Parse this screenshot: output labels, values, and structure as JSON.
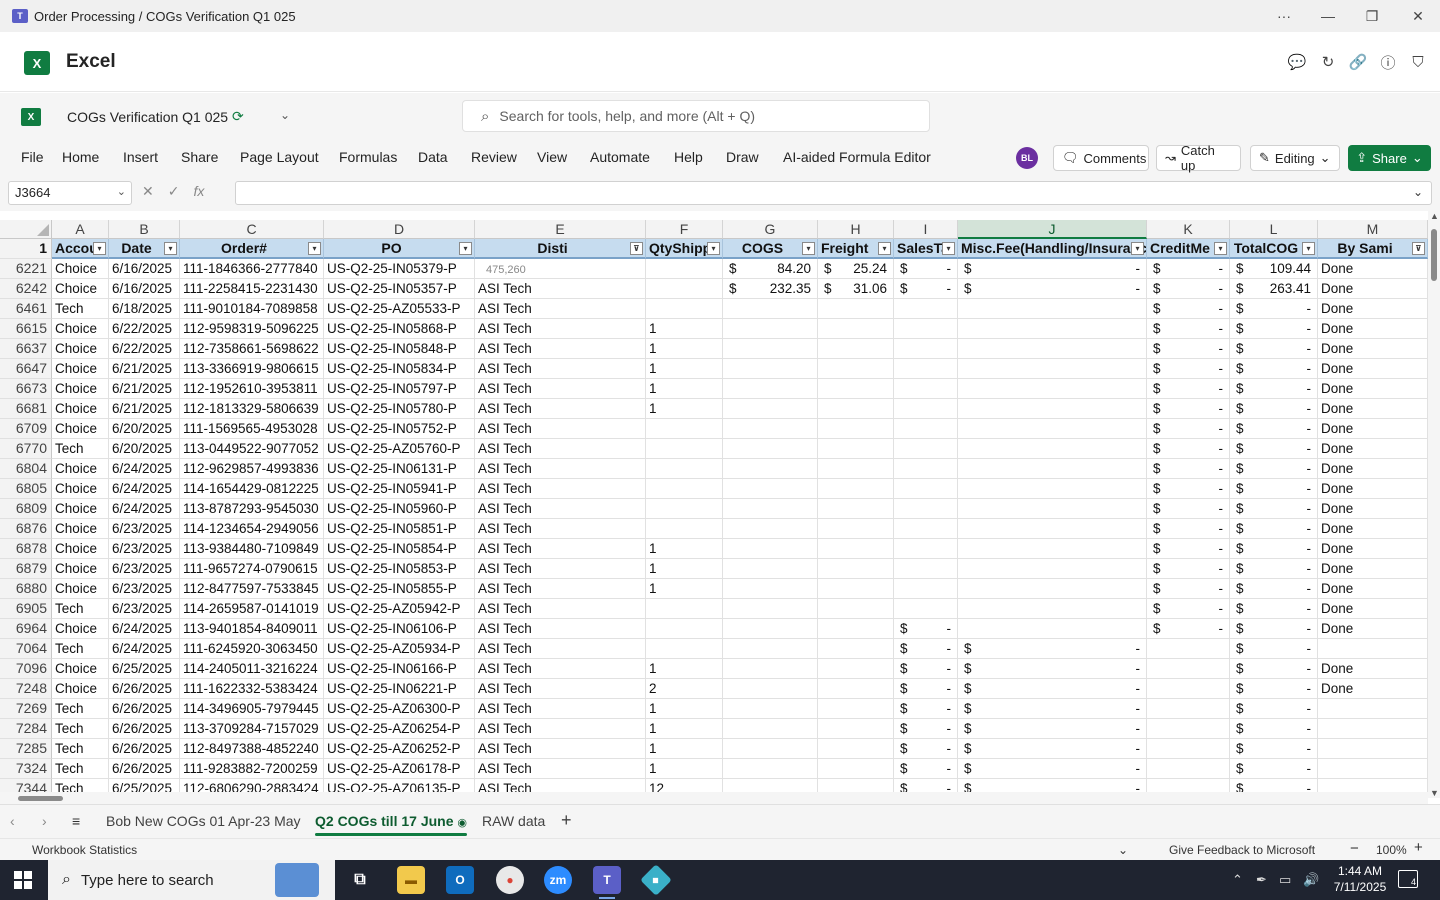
{
  "window": {
    "title": "Order Processing / COGs Verification Q1 025"
  },
  "app": {
    "name": "Excel"
  },
  "doc": {
    "name": "COGs Verification Q1 025"
  },
  "search": {
    "placeholder": "Search for tools, help, and more (Alt + Q)"
  },
  "ribbon": {
    "tabs": [
      "File",
      "Home",
      "Insert",
      "Share",
      "Page Layout",
      "Formulas",
      "Data",
      "Review",
      "View",
      "Automate",
      "Help",
      "Draw",
      "AI-aided Formula Editor"
    ],
    "avatar": "BL",
    "comments": "Comments",
    "catchup": "Catch up",
    "editing": "Editing",
    "share": "Share"
  },
  "formula_bar": {
    "name_box": "J3664",
    "content": ""
  },
  "grid": {
    "columns": [
      "A",
      "B",
      "C",
      "D",
      "E",
      "F",
      "G",
      "H",
      "I",
      "J",
      "K",
      "L",
      "M"
    ],
    "selected_column": "J",
    "header_row_number": "1",
    "headers": [
      "Accou",
      "Date",
      "Order#",
      "PO",
      "Disti",
      "QtyShipp",
      "COGS",
      "Freight",
      "SalesTa",
      "Misc.Fee(Handling/Insuranc",
      "CreditMe",
      "TotalCOG",
      "By Sami"
    ],
    "ghost_text": "475,260",
    "rows": [
      {
        "n": "6221",
        "a": "Choice",
        "b": "6/16/2025",
        "c": "111-1846366-2777840",
        "d": "US-Q2-25-IN05379-P",
        "e": "",
        "f": "",
        "g": "84.20",
        "h": "25.24",
        "i": "-",
        "j": "-",
        "k": "-",
        "l": "109.44",
        "m": "Done"
      },
      {
        "n": "6242",
        "a": "Choice",
        "b": "6/16/2025",
        "c": "111-2258415-2231430",
        "d": "US-Q2-25-IN05357-P",
        "e": "ASI Tech",
        "f": "",
        "g": "232.35",
        "h": "31.06",
        "i": "-",
        "j": "-",
        "k": "-",
        "l": "263.41",
        "m": "Done"
      },
      {
        "n": "6461",
        "a": "Tech",
        "b": "6/18/2025",
        "c": "111-9010184-7089858",
        "d": "US-Q2-25-AZ05533-P",
        "e": "ASI Tech",
        "f": "",
        "g": null,
        "h": null,
        "i": null,
        "j": null,
        "k": "-",
        "l": "-",
        "m": "Done"
      },
      {
        "n": "6615",
        "a": "Choice",
        "b": "6/22/2025",
        "c": "112-9598319-5096225",
        "d": "US-Q2-25-IN05868-P",
        "e": "ASI Tech",
        "f": "1",
        "g": null,
        "h": null,
        "i": null,
        "j": null,
        "k": "-",
        "l": "-",
        "m": "Done"
      },
      {
        "n": "6637",
        "a": "Choice",
        "b": "6/22/2025",
        "c": "112-7358661-5698622",
        "d": "US-Q2-25-IN05848-P",
        "e": "ASI Tech",
        "f": "1",
        "g": null,
        "h": null,
        "i": null,
        "j": null,
        "k": "-",
        "l": "-",
        "m": "Done"
      },
      {
        "n": "6647",
        "a": "Choice",
        "b": "6/21/2025",
        "c": "113-3366919-9806615",
        "d": "US-Q2-25-IN05834-P",
        "e": "ASI Tech",
        "f": "1",
        "g": null,
        "h": null,
        "i": null,
        "j": null,
        "k": "-",
        "l": "-",
        "m": "Done"
      },
      {
        "n": "6673",
        "a": "Choice",
        "b": "6/21/2025",
        "c": "112-1952610-3953811",
        "d": "US-Q2-25-IN05797-P",
        "e": "ASI Tech",
        "f": "1",
        "g": null,
        "h": null,
        "i": null,
        "j": null,
        "k": "-",
        "l": "-",
        "m": "Done"
      },
      {
        "n": "6681",
        "a": "Choice",
        "b": "6/21/2025",
        "c": "112-1813329-5806639",
        "d": "US-Q2-25-IN05780-P",
        "e": "ASI Tech",
        "f": "1",
        "g": null,
        "h": null,
        "i": null,
        "j": null,
        "k": "-",
        "l": "-",
        "m": "Done"
      },
      {
        "n": "6709",
        "a": "Choice",
        "b": "6/20/2025",
        "c": "111-1569565-4953028",
        "d": "US-Q2-25-IN05752-P",
        "e": "ASI Tech",
        "f": "",
        "g": null,
        "h": null,
        "i": null,
        "j": null,
        "k": "-",
        "l": "-",
        "m": "Done"
      },
      {
        "n": "6770",
        "a": "Tech",
        "b": "6/20/2025",
        "c": "113-0449522-9077052",
        "d": "US-Q2-25-AZ05760-P",
        "e": "ASI Tech",
        "f": "",
        "g": null,
        "h": null,
        "i": null,
        "j": null,
        "k": "-",
        "l": "-",
        "m": "Done"
      },
      {
        "n": "6804",
        "a": "Choice",
        "b": "6/24/2025",
        "c": "112-9629857-4993836",
        "d": "US-Q2-25-IN06131-P",
        "e": "ASI Tech",
        "f": "",
        "g": null,
        "h": null,
        "i": null,
        "j": null,
        "k": "-",
        "l": "-",
        "m": "Done"
      },
      {
        "n": "6805",
        "a": "Choice",
        "b": "6/24/2025",
        "c": "114-1654429-0812225",
        "d": "US-Q2-25-IN05941-P",
        "e": "ASI Tech",
        "f": "",
        "g": null,
        "h": null,
        "i": null,
        "j": null,
        "k": "-",
        "l": "-",
        "m": "Done"
      },
      {
        "n": "6809",
        "a": "Choice",
        "b": "6/24/2025",
        "c": "113-8787293-9545030",
        "d": "US-Q2-25-IN05960-P",
        "e": "ASI Tech",
        "f": "",
        "g": null,
        "h": null,
        "i": null,
        "j": null,
        "k": "-",
        "l": "-",
        "m": "Done"
      },
      {
        "n": "6876",
        "a": "Choice",
        "b": "6/23/2025",
        "c": "114-1234654-2949056",
        "d": "US-Q2-25-IN05851-P",
        "e": "ASI Tech",
        "f": "",
        "g": null,
        "h": null,
        "i": null,
        "j": null,
        "k": "-",
        "l": "-",
        "m": "Done"
      },
      {
        "n": "6878",
        "a": "Choice",
        "b": "6/23/2025",
        "c": "113-9384480-7109849",
        "d": "US-Q2-25-IN05854-P",
        "e": "ASI Tech",
        "f": "1",
        "g": null,
        "h": null,
        "i": null,
        "j": null,
        "k": "-",
        "l": "-",
        "m": "Done"
      },
      {
        "n": "6879",
        "a": "Choice",
        "b": "6/23/2025",
        "c": "111-9657274-0790615",
        "d": "US-Q2-25-IN05853-P",
        "e": "ASI Tech",
        "f": "1",
        "g": null,
        "h": null,
        "i": null,
        "j": null,
        "k": "-",
        "l": "-",
        "m": "Done"
      },
      {
        "n": "6880",
        "a": "Choice",
        "b": "6/23/2025",
        "c": "112-8477597-7533845",
        "d": "US-Q2-25-IN05855-P",
        "e": "ASI Tech",
        "f": "1",
        "g": null,
        "h": null,
        "i": null,
        "j": null,
        "k": "-",
        "l": "-",
        "m": "Done"
      },
      {
        "n": "6905",
        "a": "Tech",
        "b": "6/23/2025",
        "c": "114-2659587-0141019",
        "d": "US-Q2-25-AZ05942-P",
        "e": "ASI Tech",
        "f": "",
        "g": null,
        "h": null,
        "i": null,
        "j": null,
        "k": "-",
        "l": "-",
        "m": "Done"
      },
      {
        "n": "6964",
        "a": "Choice",
        "b": "6/24/2025",
        "c": "113-9401854-8409011",
        "d": "US-Q2-25-IN06106-P",
        "e": "ASI Tech",
        "f": "",
        "g": null,
        "h": null,
        "i": "-",
        "j": null,
        "k": "-",
        "l": "-",
        "m": "Done"
      },
      {
        "n": "7064",
        "a": "Tech",
        "b": "6/24/2025",
        "c": "111-6245920-3063450",
        "d": "US-Q2-25-AZ05934-P",
        "e": "ASI Tech",
        "f": "",
        "g": null,
        "h": null,
        "i": "-",
        "j": "-",
        "k": null,
        "l": "-",
        "m": ""
      },
      {
        "n": "7096",
        "a": "Choice",
        "b": "6/25/2025",
        "c": "114-2405011-3216224",
        "d": "US-Q2-25-IN06166-P",
        "e": "ASI Tech",
        "f": "1",
        "g": null,
        "h": null,
        "i": "-",
        "j": "-",
        "k": null,
        "l": "-",
        "m": "Done"
      },
      {
        "n": "7248",
        "a": "Choice",
        "b": "6/26/2025",
        "c": "111-1622332-5383424",
        "d": "US-Q2-25-IN06221-P",
        "e": "ASI Tech",
        "f": "2",
        "g": null,
        "h": null,
        "i": "-",
        "j": "-",
        "k": null,
        "l": "-",
        "m": "Done"
      },
      {
        "n": "7269",
        "a": "Tech",
        "b": "6/26/2025",
        "c": "114-3496905-7979445",
        "d": "US-Q2-25-AZ06300-P",
        "e": "ASI Tech",
        "f": "1",
        "g": null,
        "h": null,
        "i": "-",
        "j": "-",
        "k": null,
        "l": "-",
        "m": ""
      },
      {
        "n": "7284",
        "a": "Tech",
        "b": "6/26/2025",
        "c": "113-3709284-7157029",
        "d": "US-Q2-25-AZ06254-P",
        "e": "ASI Tech",
        "f": "1",
        "g": null,
        "h": null,
        "i": "-",
        "j": "-",
        "k": null,
        "l": "-",
        "m": ""
      },
      {
        "n": "7285",
        "a": "Tech",
        "b": "6/26/2025",
        "c": "112-8497388-4852240",
        "d": "US-Q2-25-AZ06252-P",
        "e": "ASI Tech",
        "f": "1",
        "g": null,
        "h": null,
        "i": "-",
        "j": "-",
        "k": null,
        "l": "-",
        "m": ""
      },
      {
        "n": "7324",
        "a": "Tech",
        "b": "6/26/2025",
        "c": "111-9283882-7200259",
        "d": "US-Q2-25-AZ06178-P",
        "e": "ASI Tech",
        "f": "1",
        "g": null,
        "h": null,
        "i": "-",
        "j": "-",
        "k": null,
        "l": "-",
        "m": ""
      },
      {
        "n": "7344",
        "a": "Tech",
        "b": "6/25/2025",
        "c": "112-6806290-2883424",
        "d": "US-Q2-25-AZ06135-P",
        "e": "ASI Tech",
        "f": "12",
        "g": null,
        "h": null,
        "i": "-",
        "j": "-",
        "k": null,
        "l": "-",
        "m": ""
      }
    ]
  },
  "sheets": {
    "tabs": [
      "Bob New COGs 01 Apr-23 May",
      "Q2 COGs till 17 June",
      "RAW data"
    ],
    "active_index": 1
  },
  "status": {
    "left": "Workbook Statistics",
    "feedback": "Give Feedback to Microsoft",
    "zoom": "100%"
  },
  "taskbar": {
    "search_placeholder": "Type here to search",
    "time": "1:44 AM",
    "date": "7/11/2025",
    "notification_count": "4"
  },
  "colors": {
    "excel_green": "#107c41",
    "header_fill": "#c6dcef",
    "taskbar": "#1f2430"
  }
}
